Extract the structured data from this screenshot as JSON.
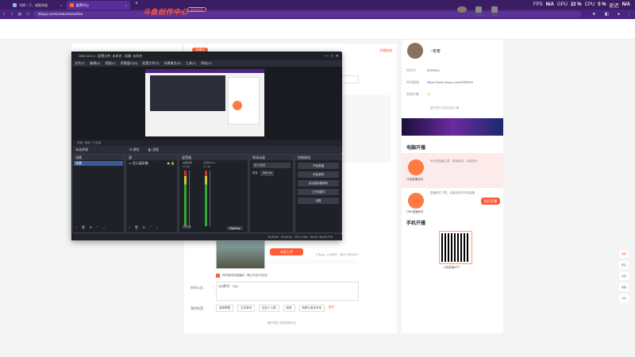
{
  "browser": {
    "tabs": [
      {
        "label": "兑换一下，就能知道",
        "active": false
      },
      {
        "label": "推荐中心",
        "active": true
      }
    ],
    "url": "douyu.com/creator/main/live",
    "hud": {
      "fps_label": "FPS",
      "fps": "N/A",
      "gpu_label": "GPU",
      "gpu": "22 %",
      "cpu_label": "CPU",
      "cpu": "5 %",
      "net_label": "延迟",
      "net": "N/A"
    }
  },
  "page": {
    "logo": "斗鱼创作中心",
    "logo_pill": "新版体验",
    "header_icons": [
      {
        "label": "下载中心",
        "icon": "download-icon"
      },
      {
        "label": "消息",
        "icon": "bell-icon"
      }
    ],
    "orange_tag": "直播间",
    "link_right": "开播指南",
    "side": {
      "username": "~老泰",
      "rows": [
        {
          "label": "房间号",
          "value": "8359954"
        },
        {
          "label": "房间链接",
          "value": "https://www.douyu.com/8359954"
        },
        {
          "label": "鱼翅余额",
          "value": "12"
        }
      ],
      "more_link": "展开更多  回到旧版主播",
      "pc_title": "电脑开播",
      "pc_items": [
        {
          "name": "斗鱼直播伴侣",
          "desc": "专业的直播工具，简单易用，功能强大"
        },
        {
          "name": "OBS直播软件",
          "desc": "直播软件下载，安装后即可开启直播"
        }
      ],
      "download_btn": "网页开播",
      "mobile_title": "手机开播",
      "qr_caption": "斗鱼直播APP"
    },
    "form": {
      "cover_btn": "本地上传",
      "cover_hint": "上传jpg，png格式，最大不超过5M",
      "checkbox_label": "同时推送到直播间（默认开启可关闭）",
      "intro_label": "房间公告",
      "intro_value": "QQ群号：QQ...",
      "tags_label": "我的标签",
      "tags": [
        "英雄联盟",
        "主机游戏",
        "战至十六周",
        "我是",
        "我是斗鱼技术帝"
      ],
      "tags_more": "更多",
      "footer_link": "展开更多  如何选择分区"
    },
    "right_rail": [
      "客服",
      "意见",
      "反馈",
      "收藏",
      "分享"
    ]
  },
  "obs": {
    "title": "OBS 32.0.0 - 配置文件: 未命名 - 场景: 未命名",
    "menu": [
      "文件(F)",
      "编辑(E)",
      "视图(V)",
      "停靠窗口(D)",
      "配置文件(P)",
      "场景集合(S)",
      "工具(T)",
      "帮助(H)"
    ],
    "scene_bar": "场景 / 录制 / 已连接",
    "toolbar": {
      "left": "未选择源",
      "mid1": "属性",
      "mid2": "滤镜"
    },
    "docks": {
      "scenes": {
        "title": "场景",
        "items": [
          "场景"
        ]
      },
      "sources": {
        "title": "源",
        "items": [
          "显示器采集"
        ]
      },
      "mixer": {
        "title": "混音器",
        "ch1": "桌面音频",
        "ch2": "麦克风/Aux",
        "db1": "0.0 dB",
        "db2": "0.0 dB"
      },
      "transitions": {
        "title": "转场动画",
        "type": "淡入淡出",
        "duration_label": "时长",
        "duration": "300 ms"
      },
      "controls": {
        "title": "控制按钮",
        "buttons": [
          "开始直播",
          "开始录制",
          "启动虚拟摄像机",
          "工作室模式",
          "设置"
        ]
      }
    },
    "status": {
      "rec": "00:00:00",
      "stream": "00:00:00",
      "cpu": "CPU: 0.5%",
      "fps": "60.00 / 60.00 FPS"
    },
    "mixer_footer": "混音器",
    "options": "Options"
  }
}
